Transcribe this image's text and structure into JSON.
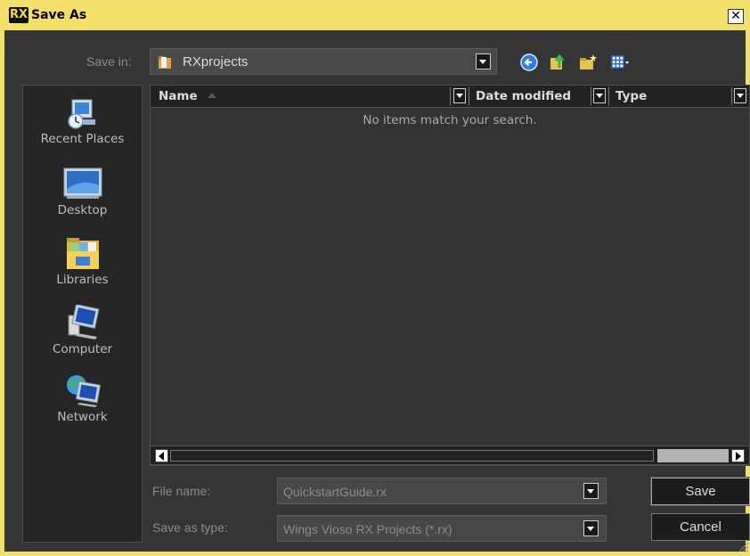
{
  "window": {
    "title": "Save As",
    "app_badge": "RX",
    "close_glyph": "✕"
  },
  "toolbar": {
    "save_in_label": "Save in:",
    "save_in_value": "RXprojects",
    "icons": [
      "back-icon",
      "up-folder-icon",
      "new-folder-icon",
      "views-menu-icon"
    ]
  },
  "places": [
    {
      "label": "Recent Places",
      "icon": "recent-places-icon"
    },
    {
      "label": "Desktop",
      "icon": "desktop-icon"
    },
    {
      "label": "Libraries",
      "icon": "libraries-icon"
    },
    {
      "label": "Computer",
      "icon": "computer-icon"
    },
    {
      "label": "Network",
      "icon": "network-icon"
    }
  ],
  "file_list": {
    "columns": [
      "Name",
      "Date modified",
      "Type"
    ],
    "empty_message": "No items match your search."
  },
  "form": {
    "file_name_label": "File name:",
    "file_name_value": "QuickstartGuide.rx",
    "save_type_label": "Save as type:",
    "save_type_value": "Wings Vioso RX Projects (*.rx)"
  },
  "buttons": {
    "save": "Save",
    "cancel": "Cancel"
  },
  "colors": {
    "frame": "#f3e06b",
    "background": "#353535",
    "sidebar": "#262626"
  }
}
